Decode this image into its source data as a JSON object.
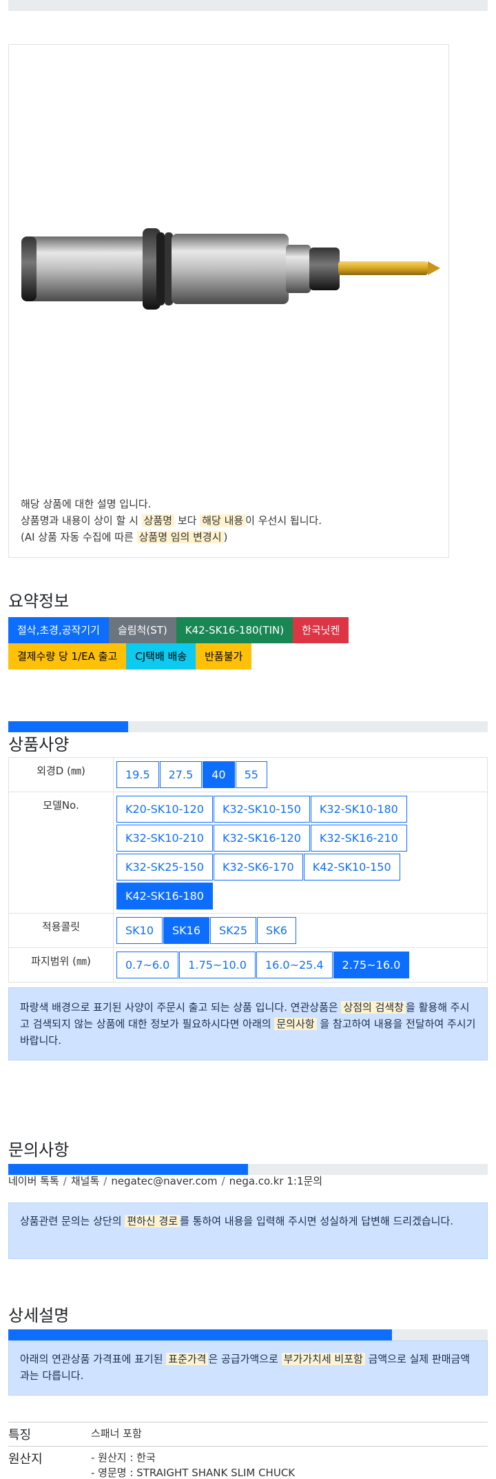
{
  "product": {
    "desc_line1": "해당 상품에 대한 설명 입니다.",
    "desc_line2_a": "상품명과 내용이 상이 할 시 ",
    "desc_line2_hl1": "상품명",
    "desc_line2_b": " 보다 ",
    "desc_line2_hl2": "해당 내용",
    "desc_line2_c": "이 우선시 됩니다.",
    "desc_line3_a": "(AI 상품 자동 수집에 따른 ",
    "desc_line3_hl": "상품명 임의 변경시",
    "desc_line3_b": ")"
  },
  "summary": {
    "title": "요약정보",
    "badges": [
      {
        "label": "절삭,초경,공작기기",
        "color": "#0d6efd",
        "text": "#ffffff"
      },
      {
        "label": "슬림척(ST)",
        "color": "#6c757d",
        "text": "#ffffff"
      },
      {
        "label": "K42-SK16-180(TIN)",
        "color": "#198754",
        "text": "#ffffff"
      },
      {
        "label": "한국닛켄",
        "color": "#dc3545",
        "text": "#ffffff"
      },
      {
        "label": "결제수량 당 1/EA 출고",
        "color": "#ffc107",
        "text": "#000000"
      },
      {
        "label": "CJ택배 배송",
        "color": "#0dcaf0",
        "text": "#000000"
      },
      {
        "label": "반품불가",
        "color": "#ffc107",
        "text": "#000000"
      }
    ]
  },
  "spec": {
    "title": "상품사양",
    "progress": 0.25,
    "rows": [
      {
        "label": "외경D (㎜)",
        "options": [
          "19.5",
          "27.5",
          "40",
          "55"
        ],
        "selected": "40"
      },
      {
        "label": "모델No.",
        "options": [
          "K20-SK10-120",
          "K32-SK10-150",
          "K32-SK10-180",
          "K32-SK10-210",
          "K32-SK16-120",
          "K32-SK16-210",
          "K32-SK25-150",
          "K32-SK6-170",
          "K42-SK10-150",
          "K42-SK16-180"
        ],
        "selected": "K42-SK16-180"
      },
      {
        "label": "적용콜릿",
        "options": [
          "SK10",
          "SK16",
          "SK25",
          "SK6"
        ],
        "selected": "SK16"
      },
      {
        "label": "파지범위 (㎜)",
        "options": [
          "0.7~6.0",
          "1.75~10.0",
          "16.0~25.4",
          "2.75~16.0"
        ],
        "selected": "2.75~16.0"
      }
    ],
    "notice_a": "파랑색 배경으로 표기된 사양이 주문시 출고 되는 상품 입니다. 연관상품은 ",
    "notice_hl1": "상점의 검색창",
    "notice_b": "을 활용해 주시고 검색되지 않는 상품에 대한 정보가 필요하시다면 아래의 ",
    "notice_hl2": "문의사항",
    "notice_c": " 을 참고하여 내용을 전달하여 주시기 바랍니다."
  },
  "inquiry": {
    "title": "문의사항",
    "progress": 0.5,
    "contacts": [
      "네이버 톡톡",
      "채널톡",
      "negatec@naver.com",
      "nega.co.kr 1:1문의"
    ],
    "separator": "/",
    "notice_a": "상품관련 문의는 상단의 ",
    "notice_hl": "편하신 경로",
    "notice_b": "를 통하여 내용을 입력해 주시면 성실하게 답변해 드리겠습니다."
  },
  "detail": {
    "title": "상세설명",
    "progress": 0.8,
    "notice_a": "아래의 연관상품 가격표에 표기된 ",
    "notice_hl1": "표준가격",
    "notice_b": "은 공급가액으로 ",
    "notice_hl2": "부가가치세 비포함",
    "notice_c": " 금액으로 실제 판매금액과는 다릅니다.",
    "features": [
      {
        "key": "특징",
        "values": [
          "스패너 포함"
        ]
      },
      {
        "key": "원산지",
        "values": [
          "- 원산지 : 한국",
          "- 영문명 : STRAIGHT SHANK SLIM CHUCK"
        ]
      }
    ]
  }
}
